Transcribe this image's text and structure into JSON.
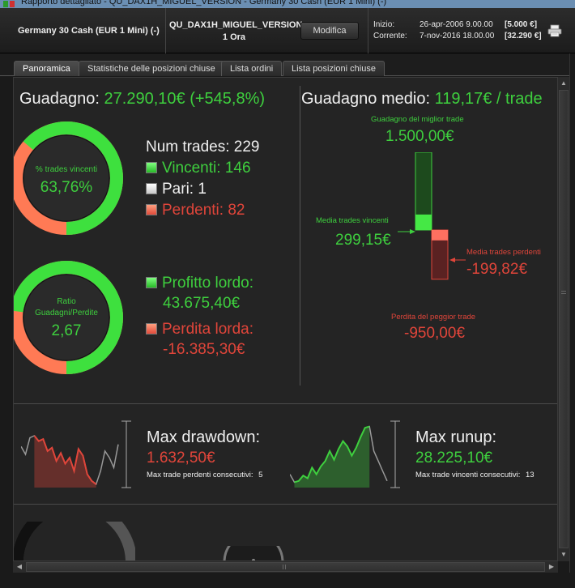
{
  "window": {
    "title": "Rapporto dettagliato - QU_DAX1H_MIGUEL_VERSION - Germany 30 Cash (EUR 1 Mini) (-)"
  },
  "header": {
    "instrument": "Germany 30 Cash (EUR 1 Mini) (-)",
    "strategy_name": "QU_DAX1H_MIGUEL_VERSION",
    "timeframe": "1 Ora",
    "modify_button": "Modifica",
    "start_label": "Inizio:",
    "start_date": "26-apr-2006 9.00.00",
    "start_value": "[5.000 €]",
    "current_label": "Corrente:",
    "current_date": "7-nov-2016 18.00.00",
    "current_value": "[32.290 €]"
  },
  "tabs": [
    {
      "label": "Panoramica",
      "active": true
    },
    {
      "label": "Statistiche delle posizioni chiuse",
      "active": false
    },
    {
      "label": "Lista ordini",
      "active": false
    },
    {
      "label": "Lista posizioni chiuse",
      "active": false
    }
  ],
  "overview": {
    "gain_label": "Guadagno:",
    "gain_value": "27.290,10€ (+545,8%)",
    "win_ring": {
      "label": "% trades vincenti",
      "value": "63,76%",
      "fraction": 0.6376
    },
    "num_trades_label": "Num trades:",
    "num_trades_value": "229",
    "winners_label": "Vincenti:",
    "winners_value": "146",
    "even_label": "Pari:",
    "even_value": "1",
    "losers_label": "Perdenti:",
    "losers_value": "82",
    "ratio_ring": {
      "label_line1": "Ratio",
      "label_line2": "Guadagni/Perdite",
      "value": "2,67",
      "fraction": 0.73
    },
    "gross_profit_label": "Profitto lordo:",
    "gross_profit_value": "43.675,40€",
    "gross_loss_label": "Perdita lorda:",
    "gross_loss_value": "-16.385,30€"
  },
  "average": {
    "title_label": "Guadagno medio:",
    "title_value": "119,17€ / trade",
    "best_label": "Guadagno del miglior trade",
    "best_value": "1.500,00€",
    "avg_win_label": "Media trades vincenti",
    "avg_win_value": "299,15€",
    "avg_loss_label": "Media trades perdenti",
    "avg_loss_value": "-199,82€",
    "worst_label": "Perdita del peggior trade",
    "worst_value": "-950,00€",
    "bar_values": {
      "best": 1500,
      "avg_win": 299.15,
      "avg_loss": -199.82,
      "worst": -950
    }
  },
  "drawdown": {
    "title": "Max drawdown:",
    "value": "1.632,50€",
    "sub_label": "Max trade perdenti consecutivi:",
    "sub_value": "5",
    "series": [
      62,
      50,
      75,
      78,
      70,
      73,
      55,
      60,
      40,
      52,
      36,
      45,
      25,
      58,
      48,
      20,
      10,
      5,
      25,
      55,
      45,
      30,
      65
    ]
  },
  "runup": {
    "title": "Max runup:",
    "value": "28.225,10€",
    "sub_label": "Max trade vincenti consecutivi:",
    "sub_value": "13",
    "series": [
      20,
      8,
      10,
      18,
      14,
      30,
      20,
      32,
      40,
      55,
      42,
      58,
      70,
      62,
      48,
      60,
      76,
      90,
      92,
      55,
      40,
      25,
      10
    ]
  },
  "colors": {
    "green": "#3ecf3e",
    "red": "#e0453a",
    "background": "#242424"
  }
}
